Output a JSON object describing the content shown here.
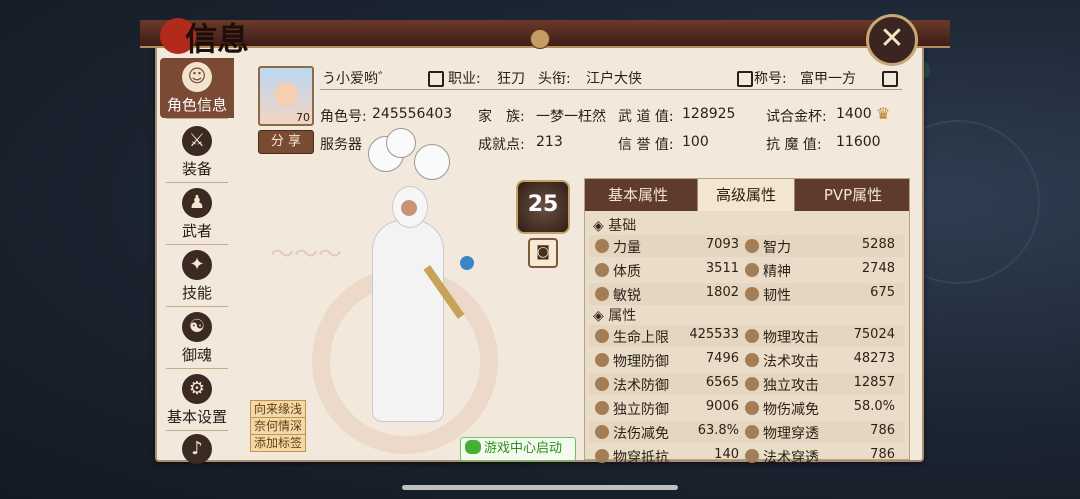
{
  "header": {
    "title": "信息",
    "close_label": "✕"
  },
  "sidebar": {
    "items": [
      {
        "label": "角色信息",
        "icon": "character-icon",
        "glyph": "☺",
        "active": true
      },
      {
        "label": "装备",
        "icon": "equipment-icon",
        "glyph": "⚔"
      },
      {
        "label": "武者",
        "icon": "warrior-icon",
        "glyph": "♟"
      },
      {
        "label": "技能",
        "icon": "skill-icon",
        "glyph": "✦"
      },
      {
        "label": "御魂",
        "icon": "soul-icon",
        "glyph": "☯"
      },
      {
        "label": "基本设置",
        "icon": "settings-icon",
        "glyph": "⚙"
      },
      {
        "label": "",
        "icon": "extra-settings-icon",
        "glyph": "♪"
      }
    ]
  },
  "profile": {
    "name": "う小爱哟゛",
    "level": "70",
    "share_label": "分 享",
    "job_label": "职业:",
    "job": "狂刀",
    "rank_label": "头衔:",
    "rank": "江户大侠",
    "title_label": "称号:",
    "title": "富甲一方",
    "id_label": "角色号:",
    "id": "245556403",
    "family_label": "家　族:",
    "family": "一梦一枉然",
    "wudao_label": "武 道 值:",
    "wudao": "128925",
    "cup_label": "试合金杯:",
    "cup": "1400",
    "server_label": "服务器",
    "achieve_label": "成就点:",
    "achieve": "213",
    "honor_label": "信 誉 值:",
    "honor": "100",
    "demon_label": "抗 魔 值:",
    "demon": "11600"
  },
  "character": {
    "stage_level": "25",
    "tags": [
      "向来缘浅",
      "奈何情深",
      "添加标签"
    ],
    "wechat_label": "游戏中心启动"
  },
  "stats": {
    "tabs": [
      "基本属性",
      "高级属性",
      "PVP属性"
    ],
    "active_tab": 1,
    "basic_title": "基础",
    "basic": [
      [
        "力量",
        "7093",
        "智力",
        "5288"
      ],
      [
        "体质",
        "3511",
        "精神",
        "2748"
      ],
      [
        "敏锐",
        "1802",
        "韧性",
        "675"
      ]
    ],
    "attr_title": "属性",
    "attrs": [
      [
        "生命上限",
        "425533",
        "物理攻击",
        "75024"
      ],
      [
        "物理防御",
        "7496",
        "法术攻击",
        "48273"
      ],
      [
        "法术防御",
        "6565",
        "独立攻击",
        "12857"
      ],
      [
        "独立防御",
        "9006",
        "物伤减免",
        "58.0%"
      ],
      [
        "法伤减免",
        "63.8%",
        "物理穿透",
        "786"
      ],
      [
        "物穿抵抗",
        "140",
        "法术穿透",
        "786"
      ]
    ]
  }
}
